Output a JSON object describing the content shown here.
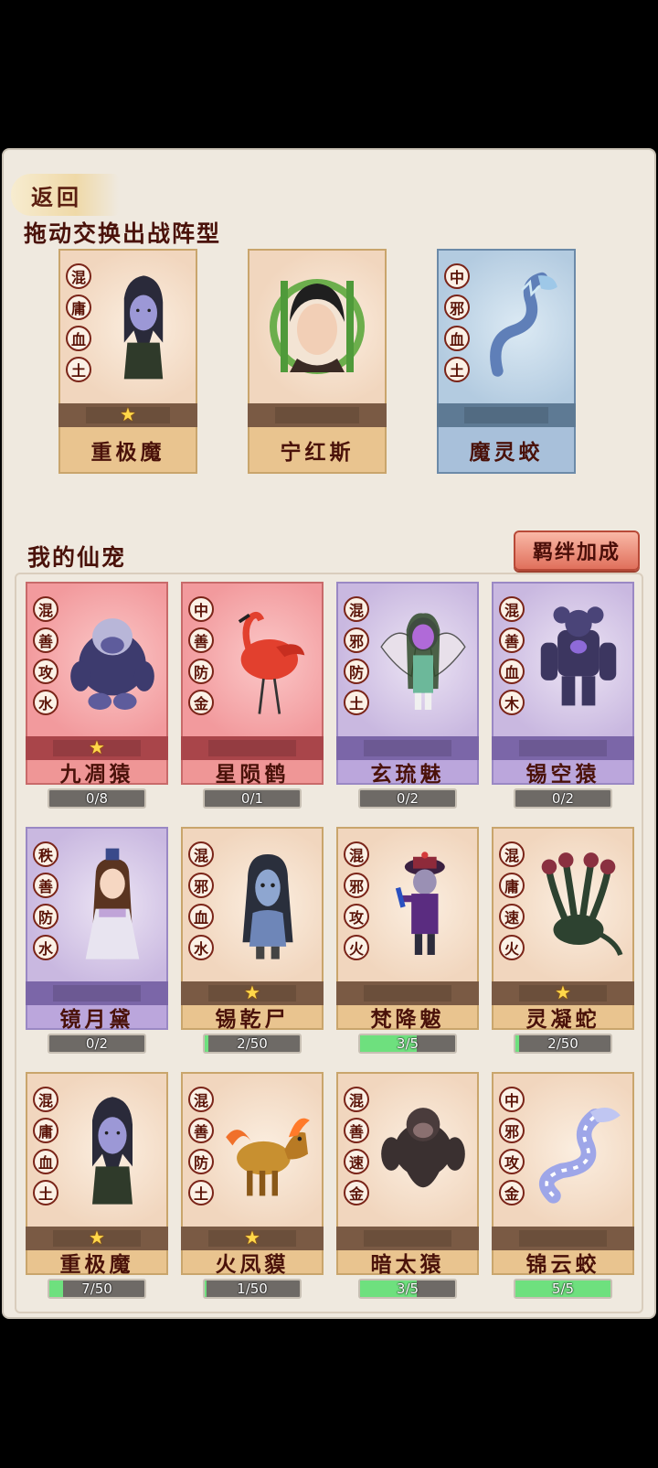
{
  "header": {
    "back_label": "返回",
    "formation_title": "拖动交换出战阵型",
    "pets_title": "我的仙宠",
    "bond_button": "羁绊加成"
  },
  "formation": [
    {
      "name": "重极魔",
      "tags": [
        "混",
        "庸",
        "血",
        "土"
      ],
      "stars": 1,
      "theme": "tan",
      "icon": "demon-icon"
    },
    {
      "name": "宁红斯",
      "tags": [],
      "stars": 0,
      "theme": "tan",
      "icon": "hero-portrait-icon"
    },
    {
      "name": "魔灵蛟",
      "tags": [
        "中",
        "邪",
        "血",
        "土"
      ],
      "stars": 0,
      "theme": "blue",
      "icon": "serpent-icon"
    }
  ],
  "pets": [
    {
      "name": "九凋猿",
      "tags": [
        "混",
        "善",
        "攻",
        "水"
      ],
      "stars": 1,
      "theme": "red",
      "progress": "0/8",
      "fill": 0,
      "icon": "ape-icon"
    },
    {
      "name": "星陨鹤",
      "tags": [
        "中",
        "善",
        "防",
        "金"
      ],
      "stars": 0,
      "theme": "red",
      "progress": "0/1",
      "fill": 0,
      "icon": "crane-icon"
    },
    {
      "name": "玄琉魅",
      "tags": [
        "混",
        "邪",
        "防",
        "土"
      ],
      "stars": 0,
      "theme": "purple",
      "progress": "0/2",
      "fill": 0,
      "icon": "winged-demon-icon"
    },
    {
      "name": "锡空猿",
      "tags": [
        "混",
        "善",
        "血",
        "木"
      ],
      "stars": 0,
      "theme": "purple",
      "progress": "0/2",
      "fill": 0,
      "icon": "golem-ape-icon"
    },
    {
      "name": "镜月黛",
      "tags": [
        "秩",
        "善",
        "防",
        "水"
      ],
      "stars": 0,
      "theme": "purple",
      "progress": "0/2",
      "fill": 0,
      "icon": "scholar-icon"
    },
    {
      "name": "锡乾尸",
      "tags": [
        "混",
        "邪",
        "血",
        "水"
      ],
      "stars": 1,
      "theme": "tan",
      "progress": "2/50",
      "fill": 0.04,
      "icon": "ghost-icon"
    },
    {
      "name": "梵降魃",
      "tags": [
        "混",
        "邪",
        "攻",
        "火"
      ],
      "stars": 0,
      "theme": "tan",
      "progress": "3/5",
      "fill": 0.6,
      "icon": "jiangshi-icon"
    },
    {
      "name": "灵凝蛇",
      "tags": [
        "混",
        "庸",
        "速",
        "火"
      ],
      "stars": 1,
      "theme": "tan",
      "progress": "2/50",
      "fill": 0.04,
      "icon": "hydra-icon"
    },
    {
      "name": "重极魔",
      "tags": [
        "混",
        "庸",
        "血",
        "土"
      ],
      "stars": 1,
      "theme": "tan",
      "progress": "7/50",
      "fill": 0.14,
      "icon": "demon-icon"
    },
    {
      "name": "火凤貘",
      "tags": [
        "混",
        "善",
        "防",
        "土"
      ],
      "stars": 1,
      "theme": "tan",
      "progress": "1/50",
      "fill": 0.02,
      "icon": "fire-beast-icon"
    },
    {
      "name": "暗太猿",
      "tags": [
        "混",
        "善",
        "速",
        "金"
      ],
      "stars": 0,
      "theme": "tan",
      "progress": "3/5",
      "fill": 0.6,
      "icon": "dark-ape-icon"
    },
    {
      "name": "锦云蛟",
      "tags": [
        "中",
        "邪",
        "攻",
        "金"
      ],
      "stars": 0,
      "theme": "tan",
      "progress": "5/5",
      "fill": 1,
      "icon": "cloud-serpent-icon"
    }
  ]
}
